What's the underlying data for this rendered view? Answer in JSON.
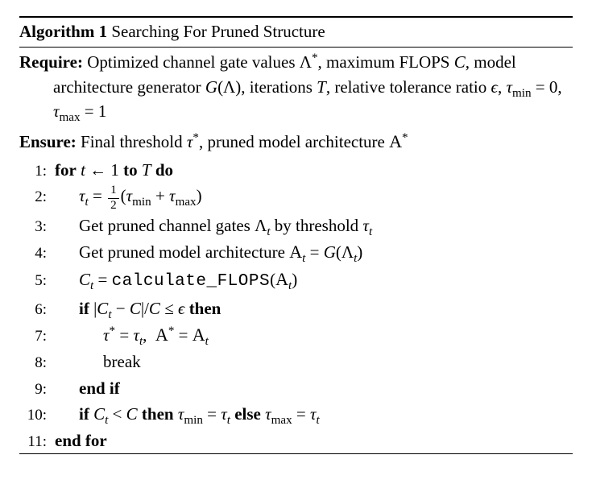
{
  "algorithm": {
    "number_label": "Algorithm 1",
    "title": "Searching For Pruned Structure",
    "require_kw": "Require:",
    "require_text_html": "Optimized channel gate values Λ<sup>*</sup>, maximum FLOPS <i>C</i>, model architecture generator <i>G</i>(Λ), iterations <i>T</i>, relative tolerance ratio <i>ϵ</i>, <i>τ</i><sub>min</sub> = 0, <i>τ</i><sub>max</sub> = 1",
    "ensure_kw": "Ensure:",
    "ensure_text_html": "Final threshold <i>τ</i><sup>*</sup>, pruned model architecture <span class=\"cal\">A</span><sup>*</sup>",
    "kw": {
      "for": "for",
      "to": "to",
      "do": "do",
      "if": "if",
      "then": "then",
      "else": "else",
      "endif": "end if",
      "endfor": "end for",
      "break": "break"
    },
    "lines": {
      "l1_html": "<span class=\"kw\">for</span> <i>t</i> ← 1 <span class=\"kw\">to</span> <i>T</i> <span class=\"kw\">do</span>",
      "l2_html": "<i>τ</i><sub><i>t</i></sub> = <span class=\"frac\"><span class=\"fn\">1</span><span class=\"fd\">2</span></span>(<i>τ</i><sub>min</sub> + <i>τ</i><sub>max</sub>)",
      "l3_html": "Get pruned channel gates Λ<sub><i>t</i></sub> by threshold <i>τ</i><sub><i>t</i></sub>",
      "l4_html": "Get pruned model architecture <span class=\"cal\">A</span><sub><i>t</i></sub> = <i>G</i>(Λ<sub><i>t</i></sub>)",
      "l5_html": "<i>C</i><sub><i>t</i></sub> = <span class=\"tt\">calculate&#95;FLOPS</span>(<span class=\"cal\">A</span><sub><i>t</i></sub>)",
      "l6_html": "<span class=\"kw\">if</span> |<i>C</i><sub><i>t</i></sub> − <i>C</i>|/<i>C</i> ≤ <i>ϵ</i> <span class=\"kw\">then</span>",
      "l7_html": "<i>τ</i><sup>*</sup> = <i>τ</i><sub><i>t</i></sub>,&nbsp; <span class=\"cal\">A</span><sup>*</sup> = <span class=\"cal\">A</span><sub><i>t</i></sub>",
      "l8_html": "break",
      "l9_html": "<span class=\"kw\">end if</span>",
      "l10_html": "<span class=\"kw\">if</span> <i>C</i><sub><i>t</i></sub> &lt; <i>C</i> <span class=\"kw\">then</span> <i>τ</i><sub>min</sub> = <i>τ</i><sub><i>t</i></sub> <span class=\"kw\">else</span> <i>τ</i><sub>max</sub> = <i>τ</i><sub><i>t</i></sub>",
      "l11_html": "<span class=\"kw\">end for</span>"
    }
  }
}
